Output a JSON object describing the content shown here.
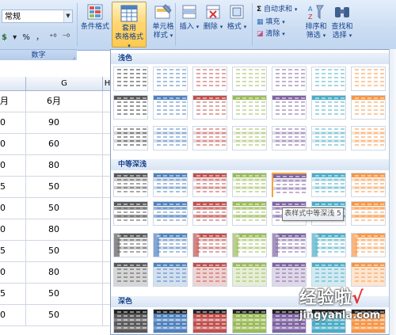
{
  "ribbon": {
    "number_format_value": "常规",
    "format_buttons": [
      "▾",
      "%",
      "，",
      "⁺⁰",
      "⁻⁰"
    ],
    "number_group_label": "数字",
    "conditional_format": "条件格式",
    "format_as_table_line1": "套用",
    "format_as_table_line2": "表格格式",
    "cell_styles_line1": "单元格",
    "cell_styles_line2": "样式",
    "insert": "插入",
    "delete": "删除",
    "format": "格式",
    "autosum": "自动求和",
    "fill": "填充",
    "clear": "清除",
    "sort_filter_line1": "排序和",
    "sort_filter_line2": "筛选",
    "find_select_line1": "查找和",
    "find_select_line2": "选择"
  },
  "sheet": {
    "columns": [
      "",
      "G",
      "H"
    ],
    "header_f": "月",
    "header_g": "6月",
    "rows": [
      {
        "f": "0",
        "g": "90"
      },
      {
        "f": "0",
        "g": "60"
      },
      {
        "f": "0",
        "g": "80"
      },
      {
        "f": "5",
        "g": "50"
      },
      {
        "f": "0",
        "g": "50"
      },
      {
        "f": "0",
        "g": "80"
      },
      {
        "f": "5",
        "g": "50"
      },
      {
        "f": "0",
        "g": "80"
      },
      {
        "f": "5",
        "g": "50"
      },
      {
        "f": "0",
        "g": "50"
      }
    ]
  },
  "gallery": {
    "sections": [
      "浅色",
      "中等深浅",
      "深色"
    ],
    "tooltip": "表样式中等深浅 5",
    "palette": [
      "#595959",
      "#4f81bd",
      "#c0504d",
      "#9bbb59",
      "#8064a2",
      "#4bacc6",
      "#f79646"
    ]
  },
  "watermark": {
    "line1": "经验啦",
    "check": "√",
    "line2": "jingyanla.com"
  }
}
